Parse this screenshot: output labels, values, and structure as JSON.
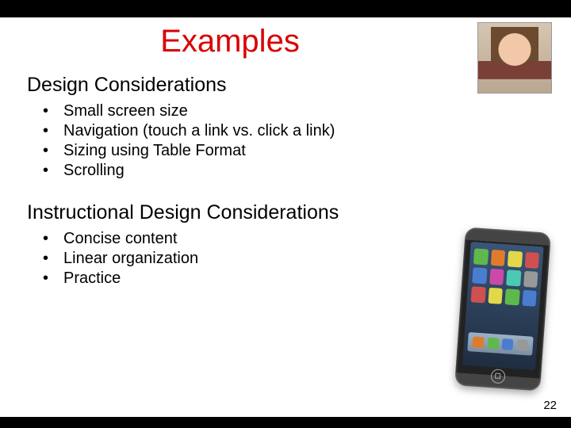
{
  "title": "Examples",
  "section1": {
    "heading": "Design Considerations",
    "items": [
      "Small screen size",
      "Navigation (touch a link vs. click a link)",
      "Sizing using Table Format",
      "Scrolling"
    ]
  },
  "section2": {
    "heading": "Instructional Design Considerations",
    "items": [
      "Concise content",
      "Linear organization",
      "Practice"
    ]
  },
  "page_number": "22"
}
